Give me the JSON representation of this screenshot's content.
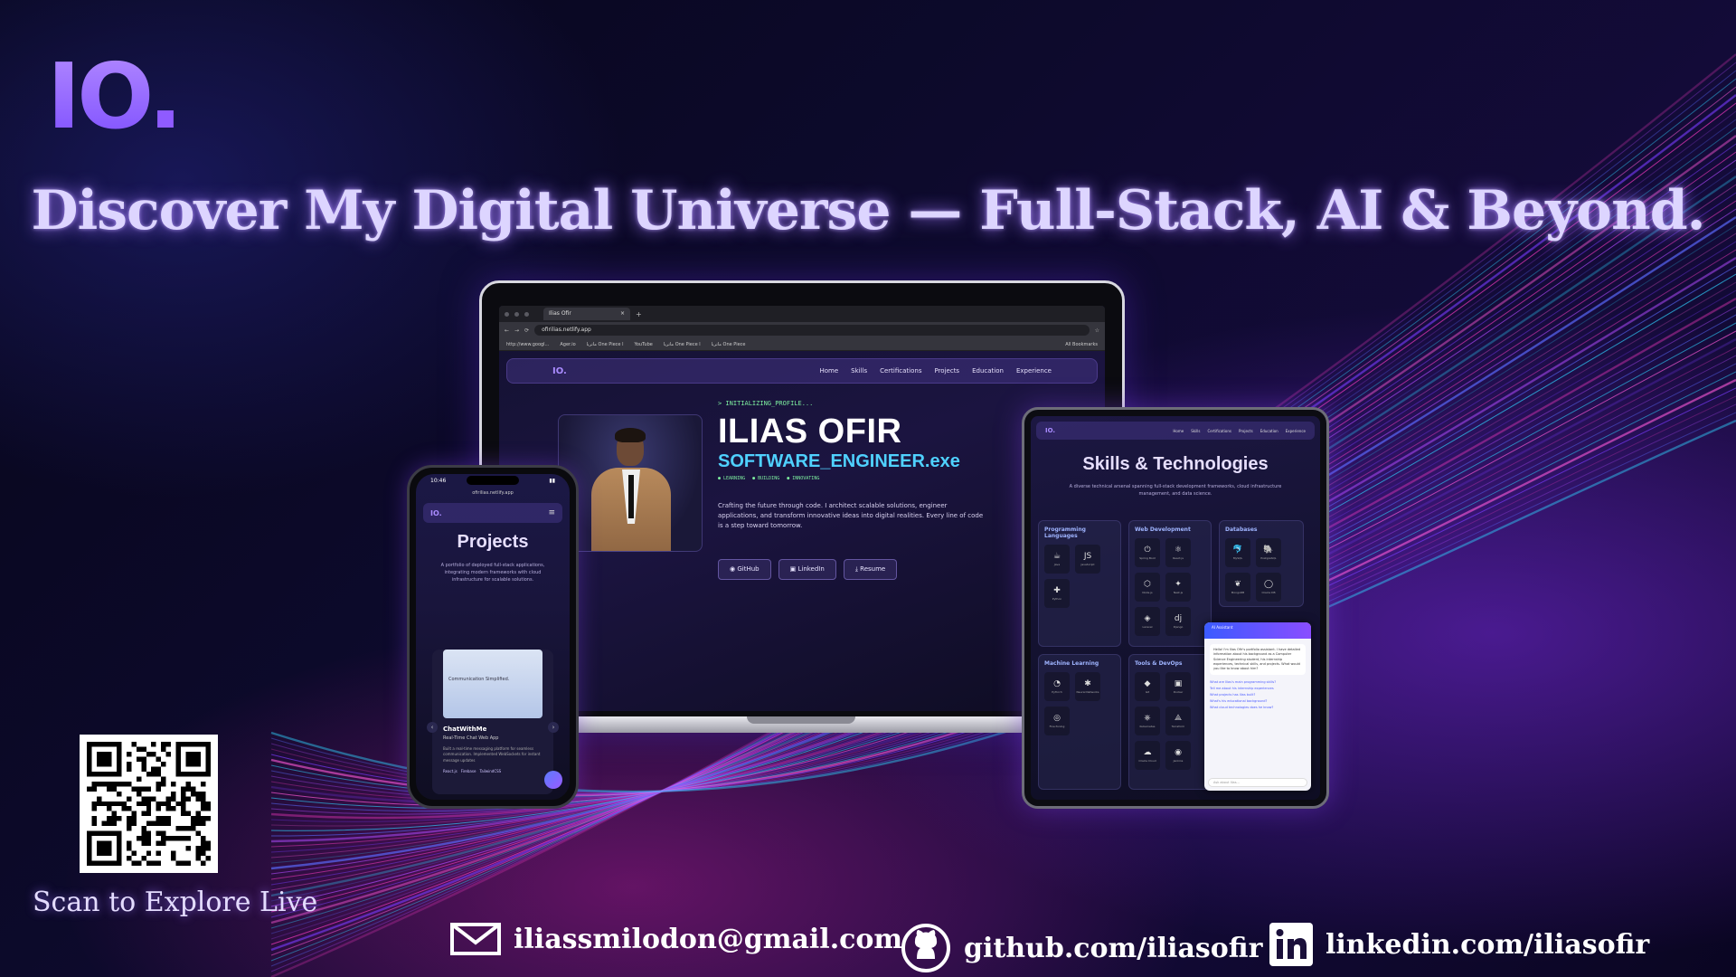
{
  "brand": {
    "logo_text": "IO",
    "logo_dot": "."
  },
  "headline": "Discover My Digital Universe — Full-Stack, AI & Beyond.",
  "laptop": {
    "browser": {
      "tab_title": "Ilias Ofir",
      "url": "ofirilias.netlify.app",
      "bookmarks": [
        "http://www.googl...",
        "Ager.io",
        "ماتريا One Piece ا",
        "YouTube",
        "ماتريا One Piece ا",
        "ماتريا One Piece",
        "All Bookmarks"
      ]
    },
    "nav": {
      "brand": "IO.",
      "links": [
        "Home",
        "Skills",
        "Certifications",
        "Projects",
        "Education",
        "Experience"
      ]
    },
    "hero": {
      "init": "> INITIALIZING_PROFILE...",
      "name": "ILIAS OFIR",
      "role": "SOFTWARE_ENGINEER.exe",
      "tags": [
        "● LEARNING",
        "● BUILDING",
        "● INNOVATING"
      ],
      "description": "Crafting the future through code. I architect scalable solutions, engineer applications, and transform innovative ideas into digital realities. Every line of code is a step toward tomorrow.",
      "buttons": [
        "GitHub",
        "LinkedIn",
        "Resume"
      ]
    }
  },
  "tablet": {
    "nav": {
      "brand": "IO.",
      "links": [
        "Home",
        "Skills",
        "Certifications",
        "Projects",
        "Education",
        "Experience"
      ]
    },
    "title": "Skills & Technologies",
    "subtitle": "A diverse technical arsenal spanning full-stack development frameworks, cloud infrastructure management, and data science.",
    "cards": [
      {
        "title": "Programming Languages",
        "icons": [
          [
            "☕",
            "Java"
          ],
          [
            "JS",
            "JavaScript"
          ],
          [
            "✚",
            "Python"
          ]
        ]
      },
      {
        "title": "Web Development",
        "icons": [
          [
            "⏻",
            "Spring Boot"
          ],
          [
            "⚛",
            "React.js"
          ],
          [
            "⬡",
            "Node.js"
          ],
          [
            "✦",
            "Nest.js"
          ],
          [
            "◈",
            "Laravel"
          ],
          [
            "dj",
            "Django"
          ]
        ]
      },
      {
        "title": "Databases",
        "icons": [
          [
            "🐬",
            "MySQL"
          ],
          [
            "🐘",
            "PostgreSQL"
          ],
          [
            "❦",
            "MongoDB"
          ],
          [
            "◯",
            "Oracle DB"
          ]
        ]
      },
      {
        "title": "Machine Learning",
        "icons": [
          [
            "◔",
            "PyTorch"
          ],
          [
            "✱",
            "Neural Networks"
          ],
          [
            "◎",
            "Fine-Tuning"
          ]
        ]
      },
      {
        "title": "Tools & DevOps",
        "icons": [
          [
            "◆",
            "Git"
          ],
          [
            "▣",
            "Docker"
          ],
          [
            "⎈",
            "Kubernetes"
          ],
          [
            "⟁",
            "Terraform"
          ],
          [
            "☁",
            "Oracle Cloud"
          ],
          [
            "◉",
            "Jenkins"
          ]
        ]
      }
    ],
    "chat": {
      "header": "AI Assistant",
      "message": "Hello! I'm Ilias Ofir's portfolio assistant. I have detailed information about his background as a Computer Science Engineering student, his internship experiences, technical skills, and projects. What would you like to know about him?",
      "questions": [
        "What are Ilias's main programming skills?",
        "Tell me about his internship experiences",
        "What projects has Ilias built?",
        "What's his educational background?",
        "What cloud technologies does he know?"
      ],
      "placeholder": "Ask about Ilias..."
    }
  },
  "phone": {
    "time": "10:46",
    "url": "ofirilias.netlify.app",
    "nav": {
      "brand": "IO.",
      "menu": "≡"
    },
    "title": "Projects",
    "subtitle": "A portfolio of deployed full-stack applications, integrating modern frameworks with cloud infrastructure for scalable solutions.",
    "project": {
      "thumb_text": "Communication Simplified.",
      "name": "ChatWithMe",
      "subtitle": "Real-Time Chat Web App",
      "description": "Built a real-time messaging platform for seamless communication. Implemented WebSockets for instant message updates",
      "tags": [
        "React.js",
        "Firebase",
        "TailwindCSS"
      ]
    }
  },
  "qr_label": "Scan to Explore Live",
  "contacts": {
    "email": "iliassmilodon@gmail.com",
    "github": "github.com/iliasofir",
    "linkedin": "linkedin.com/iliasofir"
  },
  "colors": {
    "accent": "#8f5bff",
    "headline_glow": "#a078ff",
    "cyan": "#4fd1ff",
    "green": "#7ef0a0"
  }
}
